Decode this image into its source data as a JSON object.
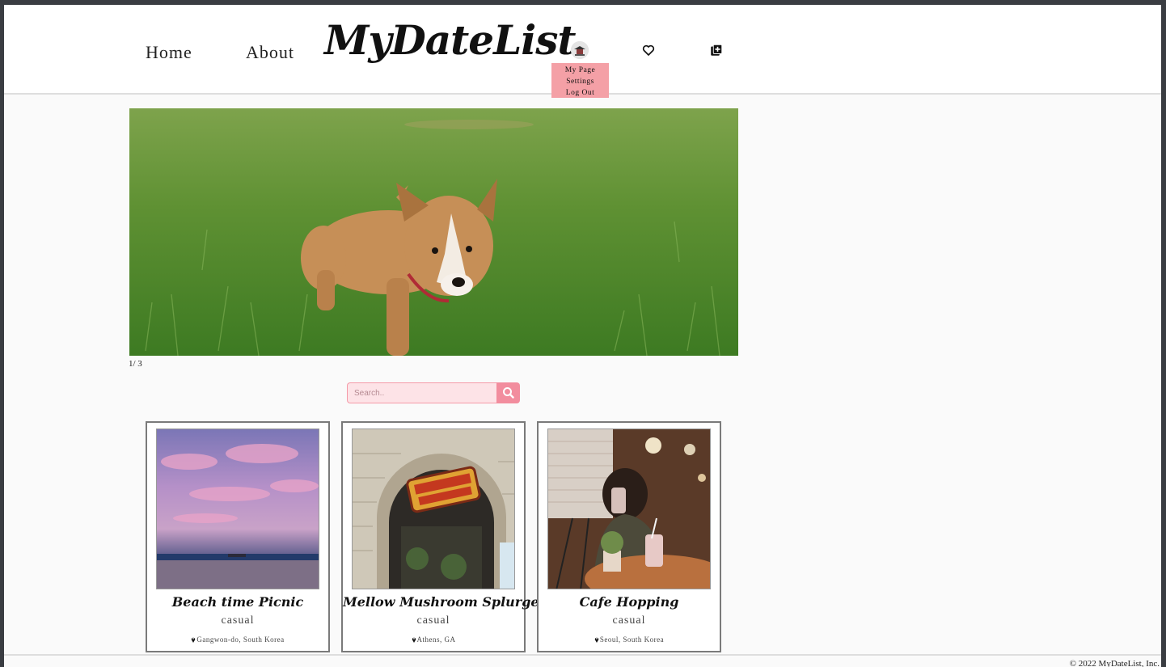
{
  "nav": {
    "home": "Home",
    "about": "About",
    "logo": "MyDateList"
  },
  "user_menu": {
    "items": [
      "My Page",
      "Settings",
      "Log Out"
    ]
  },
  "icons": {
    "heart": "heart-icon",
    "add": "add-list-icon",
    "search": "search-icon",
    "pin": "location-pin-icon"
  },
  "carousel": {
    "counter": "1/ 3"
  },
  "search": {
    "placeholder": "Search.."
  },
  "cards": [
    {
      "title": "Beach time Picnic",
      "tag": "casual",
      "location": "Gangwon-do, South Korea"
    },
    {
      "title": "Mellow Mushroom Splurge",
      "tag": "casual",
      "location": "Athens, GA"
    },
    {
      "title": "Cafe Hopping",
      "tag": "casual",
      "location": "Seoul, South Korea"
    }
  ],
  "footer": {
    "copyright": "© 2022 MyDateList, Inc."
  },
  "colors": {
    "accent_pink": "#f28d9e",
    "dropdown_pink": "#f4a0a6",
    "search_bg": "#fde3e7"
  }
}
